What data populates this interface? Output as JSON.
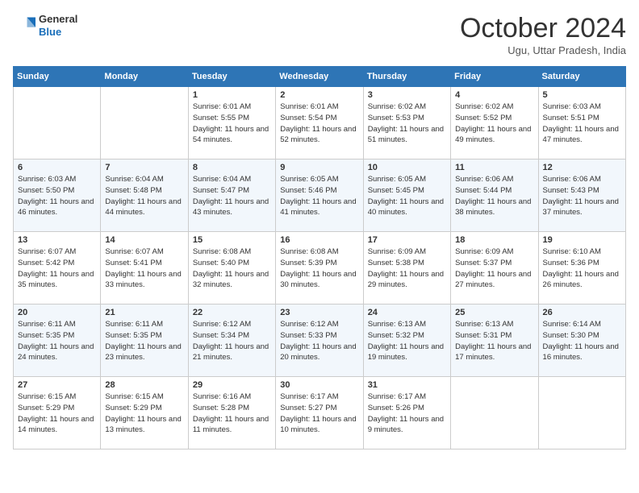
{
  "logo": {
    "general": "General",
    "blue": "Blue"
  },
  "header": {
    "month": "October 2024",
    "location": "Ugu, Uttar Pradesh, India"
  },
  "weekdays": [
    "Sunday",
    "Monday",
    "Tuesday",
    "Wednesday",
    "Thursday",
    "Friday",
    "Saturday"
  ],
  "weeks": [
    [
      {
        "day": "",
        "info": ""
      },
      {
        "day": "",
        "info": ""
      },
      {
        "day": "1",
        "info": "Sunrise: 6:01 AM\nSunset: 5:55 PM\nDaylight: 11 hours and 54 minutes."
      },
      {
        "day": "2",
        "info": "Sunrise: 6:01 AM\nSunset: 5:54 PM\nDaylight: 11 hours and 52 minutes."
      },
      {
        "day": "3",
        "info": "Sunrise: 6:02 AM\nSunset: 5:53 PM\nDaylight: 11 hours and 51 minutes."
      },
      {
        "day": "4",
        "info": "Sunrise: 6:02 AM\nSunset: 5:52 PM\nDaylight: 11 hours and 49 minutes."
      },
      {
        "day": "5",
        "info": "Sunrise: 6:03 AM\nSunset: 5:51 PM\nDaylight: 11 hours and 47 minutes."
      }
    ],
    [
      {
        "day": "6",
        "info": "Sunrise: 6:03 AM\nSunset: 5:50 PM\nDaylight: 11 hours and 46 minutes."
      },
      {
        "day": "7",
        "info": "Sunrise: 6:04 AM\nSunset: 5:48 PM\nDaylight: 11 hours and 44 minutes."
      },
      {
        "day": "8",
        "info": "Sunrise: 6:04 AM\nSunset: 5:47 PM\nDaylight: 11 hours and 43 minutes."
      },
      {
        "day": "9",
        "info": "Sunrise: 6:05 AM\nSunset: 5:46 PM\nDaylight: 11 hours and 41 minutes."
      },
      {
        "day": "10",
        "info": "Sunrise: 6:05 AM\nSunset: 5:45 PM\nDaylight: 11 hours and 40 minutes."
      },
      {
        "day": "11",
        "info": "Sunrise: 6:06 AM\nSunset: 5:44 PM\nDaylight: 11 hours and 38 minutes."
      },
      {
        "day": "12",
        "info": "Sunrise: 6:06 AM\nSunset: 5:43 PM\nDaylight: 11 hours and 37 minutes."
      }
    ],
    [
      {
        "day": "13",
        "info": "Sunrise: 6:07 AM\nSunset: 5:42 PM\nDaylight: 11 hours and 35 minutes."
      },
      {
        "day": "14",
        "info": "Sunrise: 6:07 AM\nSunset: 5:41 PM\nDaylight: 11 hours and 33 minutes."
      },
      {
        "day": "15",
        "info": "Sunrise: 6:08 AM\nSunset: 5:40 PM\nDaylight: 11 hours and 32 minutes."
      },
      {
        "day": "16",
        "info": "Sunrise: 6:08 AM\nSunset: 5:39 PM\nDaylight: 11 hours and 30 minutes."
      },
      {
        "day": "17",
        "info": "Sunrise: 6:09 AM\nSunset: 5:38 PM\nDaylight: 11 hours and 29 minutes."
      },
      {
        "day": "18",
        "info": "Sunrise: 6:09 AM\nSunset: 5:37 PM\nDaylight: 11 hours and 27 minutes."
      },
      {
        "day": "19",
        "info": "Sunrise: 6:10 AM\nSunset: 5:36 PM\nDaylight: 11 hours and 26 minutes."
      }
    ],
    [
      {
        "day": "20",
        "info": "Sunrise: 6:11 AM\nSunset: 5:35 PM\nDaylight: 11 hours and 24 minutes."
      },
      {
        "day": "21",
        "info": "Sunrise: 6:11 AM\nSunset: 5:35 PM\nDaylight: 11 hours and 23 minutes."
      },
      {
        "day": "22",
        "info": "Sunrise: 6:12 AM\nSunset: 5:34 PM\nDaylight: 11 hours and 21 minutes."
      },
      {
        "day": "23",
        "info": "Sunrise: 6:12 AM\nSunset: 5:33 PM\nDaylight: 11 hours and 20 minutes."
      },
      {
        "day": "24",
        "info": "Sunrise: 6:13 AM\nSunset: 5:32 PM\nDaylight: 11 hours and 19 minutes."
      },
      {
        "day": "25",
        "info": "Sunrise: 6:13 AM\nSunset: 5:31 PM\nDaylight: 11 hours and 17 minutes."
      },
      {
        "day": "26",
        "info": "Sunrise: 6:14 AM\nSunset: 5:30 PM\nDaylight: 11 hours and 16 minutes."
      }
    ],
    [
      {
        "day": "27",
        "info": "Sunrise: 6:15 AM\nSunset: 5:29 PM\nDaylight: 11 hours and 14 minutes."
      },
      {
        "day": "28",
        "info": "Sunrise: 6:15 AM\nSunset: 5:29 PM\nDaylight: 11 hours and 13 minutes."
      },
      {
        "day": "29",
        "info": "Sunrise: 6:16 AM\nSunset: 5:28 PM\nDaylight: 11 hours and 11 minutes."
      },
      {
        "day": "30",
        "info": "Sunrise: 6:17 AM\nSunset: 5:27 PM\nDaylight: 11 hours and 10 minutes."
      },
      {
        "day": "31",
        "info": "Sunrise: 6:17 AM\nSunset: 5:26 PM\nDaylight: 11 hours and 9 minutes."
      },
      {
        "day": "",
        "info": ""
      },
      {
        "day": "",
        "info": ""
      }
    ]
  ]
}
